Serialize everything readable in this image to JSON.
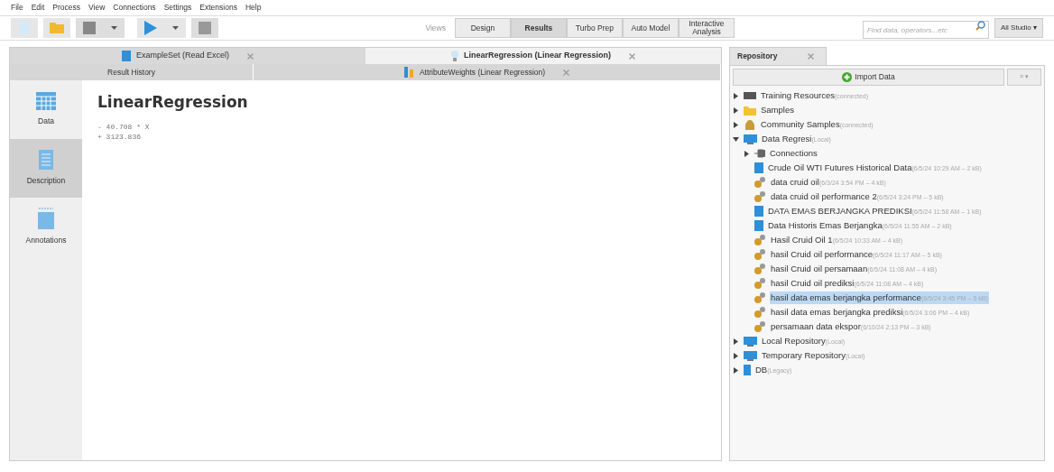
{
  "menu": [
    "File",
    "Edit",
    "Process",
    "View",
    "Connections",
    "Settings",
    "Extensions",
    "Help"
  ],
  "views": {
    "label": "Views",
    "items": [
      {
        "label": "Design",
        "selected": false
      },
      {
        "label": "Results",
        "selected": true
      },
      {
        "label": "Turbo Prep",
        "selected": false
      },
      {
        "label": "Auto Model",
        "selected": false
      },
      {
        "label": "Interactive Analysis",
        "selected": false
      }
    ]
  },
  "search": {
    "placeholder": "Find data, operators...etc",
    "scope": "All Studio ▾"
  },
  "result_tabs": [
    {
      "label": "ExampleSet (Read Excel)",
      "kind": "table",
      "selected": false
    },
    {
      "label": "LinearRegression (Linear Regression)",
      "kind": "model",
      "selected": true
    }
  ],
  "result_tabs_2": [
    {
      "label": "Result History",
      "kind": "none",
      "selected": false
    },
    {
      "label": "AttributeWeights (Linear Regression)",
      "kind": "weights",
      "selected": false
    }
  ],
  "side_views": [
    {
      "label": "Data",
      "kind": "data",
      "selected": false
    },
    {
      "label": "Description",
      "kind": "description",
      "selected": true
    },
    {
      "label": "Annotations",
      "kind": "annotations",
      "selected": false
    }
  ],
  "model": {
    "title": "LinearRegression",
    "lines": [
      "- 40.708 * X",
      "+ 3123.836"
    ]
  },
  "repository": {
    "tab": "Repository",
    "import": "Import Data",
    "menu": "≡ ▾",
    "tree": [
      {
        "label": "Training Resources",
        "meta": "(connected)",
        "kind": "server",
        "expanded": false,
        "selected": false
      },
      {
        "label": "Samples",
        "kind": "folder",
        "expanded": false,
        "selected": false
      },
      {
        "label": "Community Samples",
        "meta": "(connected)",
        "kind": "community",
        "expanded": false,
        "selected": false
      },
      {
        "label": "Data Regresi",
        "meta": "(Local)",
        "kind": "repo",
        "expanded": true,
        "selected": false,
        "children": [
          {
            "label": "Connections",
            "kind": "connections",
            "expanded": false,
            "selected": false
          },
          {
            "label": "Crude Oil WTI Futures Historical Data",
            "meta": "(6/5/24 10:29 AM – 2 kB)",
            "kind": "data",
            "selected": false
          },
          {
            "label": "data cruid oil",
            "meta": "(6/3/24 3:54 PM – 4 kB)",
            "kind": "model",
            "selected": false
          },
          {
            "label": "data cruid oil performance 2",
            "meta": "(6/5/24 3:24 PM – 5 kB)",
            "kind": "model",
            "selected": false
          },
          {
            "label": "DATA EMAS BERJANGKA PREDIKSI",
            "meta": "(6/5/24 11:58 AM – 1 kB)",
            "kind": "data",
            "selected": false
          },
          {
            "label": "Data Historis Emas Berjangka",
            "meta": "(6/5/24 11:55 AM – 2 kB)",
            "kind": "data",
            "selected": false
          },
          {
            "label": "Hasil Cruid Oil 1",
            "meta": "(6/5/24 10:33 AM – 4 kB)",
            "kind": "model",
            "selected": false
          },
          {
            "label": "hasil Cruid oil performance",
            "meta": "(6/5/24 11:17 AM – 5 kB)",
            "kind": "model",
            "selected": false
          },
          {
            "label": "hasil Cruid oil persamaan",
            "meta": "(6/5/24 11:08 AM – 4 kB)",
            "kind": "model",
            "selected": false
          },
          {
            "label": "hasil Cruid oil prediksi",
            "meta": "(6/5/24 11:08 AM – 4 kB)",
            "kind": "model",
            "selected": false
          },
          {
            "label": "hasil data emas berjangka performance",
            "meta": "(6/5/24 3:45 PM – 5 kB)",
            "kind": "model",
            "selected": true
          },
          {
            "label": "hasil data emas berjangka prediksi",
            "meta": "(6/5/24 3:06 PM – 4 kB)",
            "kind": "model",
            "selected": false
          },
          {
            "label": "persamaan data ekspor",
            "meta": "(6/10/24 2:13 PM – 3 kB)",
            "kind": "model",
            "selected": false
          }
        ]
      },
      {
        "label": "Local Repository",
        "meta": "(Local)",
        "kind": "repo",
        "expanded": false,
        "selected": false
      },
      {
        "label": "Temporary Repository",
        "meta": "(Local)",
        "kind": "repo",
        "expanded": false,
        "selected": false
      },
      {
        "label": "DB",
        "meta": "(Legacy)",
        "kind": "db",
        "expanded": false,
        "selected": false
      }
    ]
  }
}
